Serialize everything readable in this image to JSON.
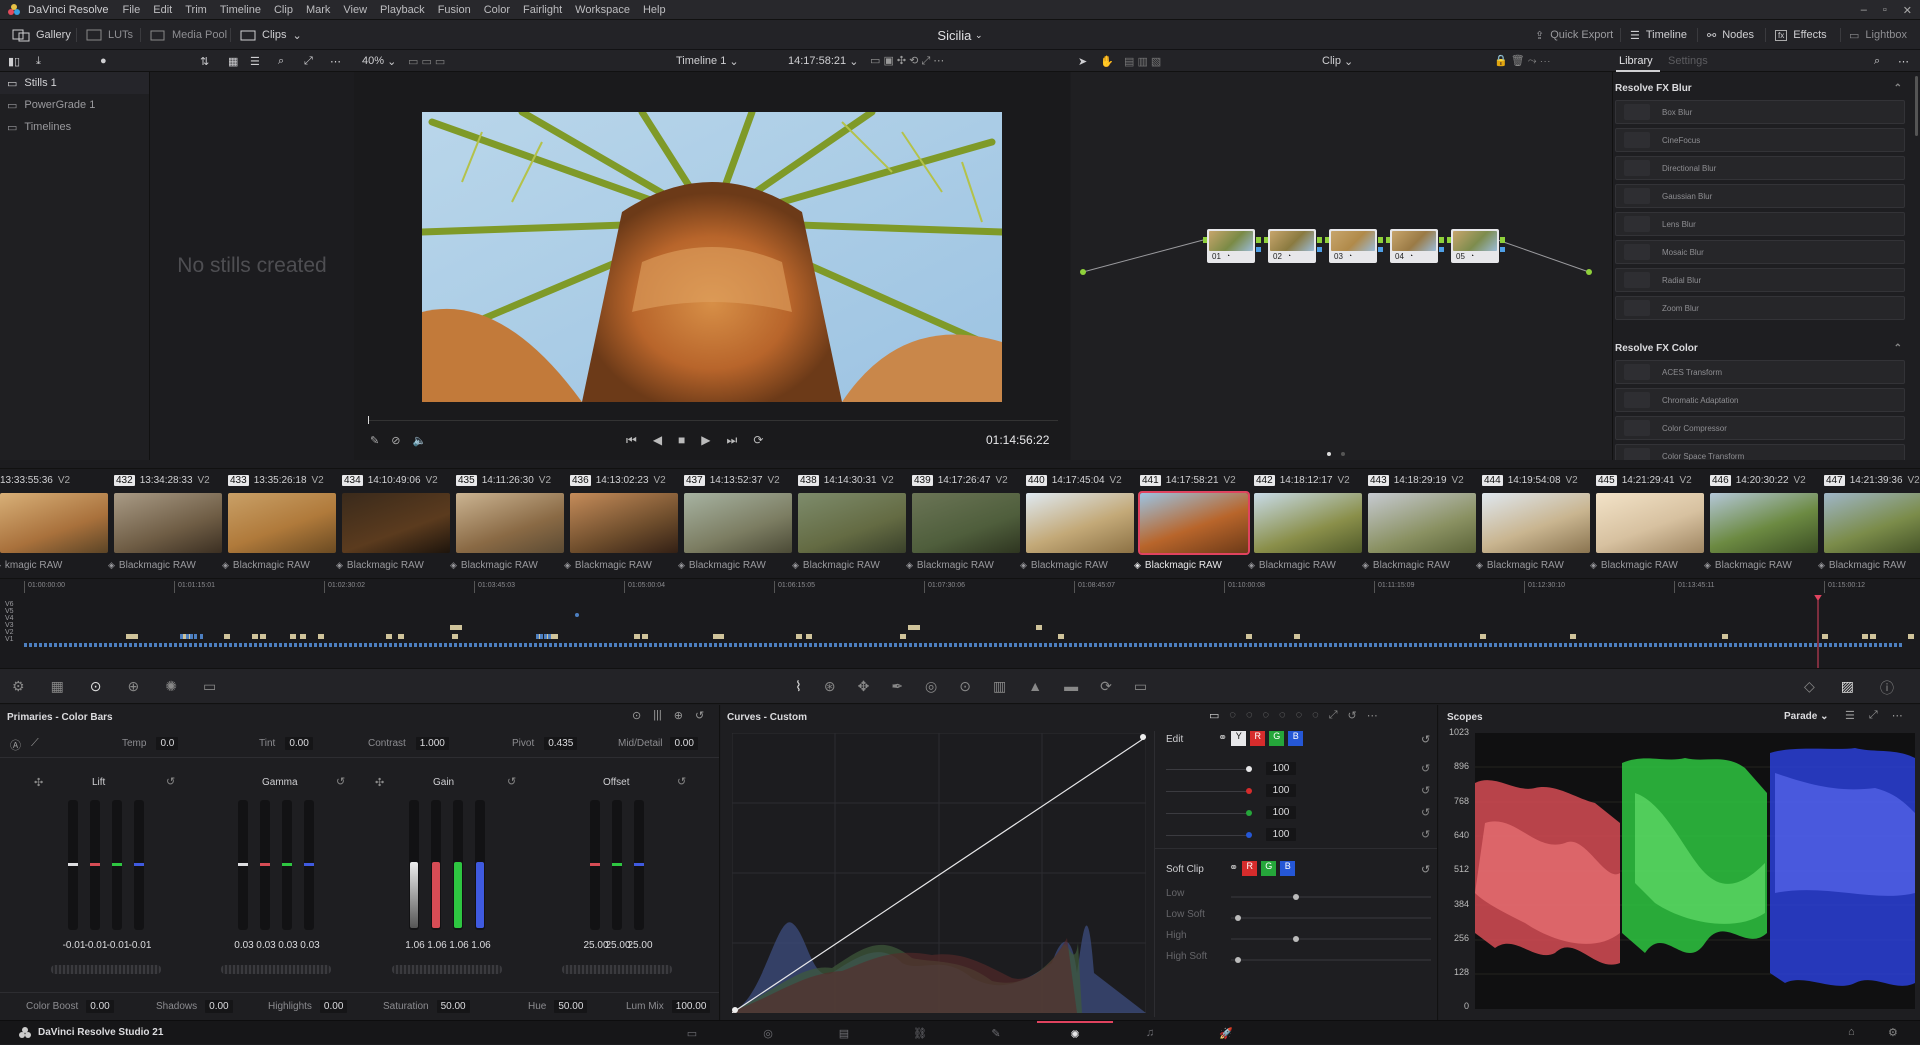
{
  "menubar": {
    "app": "DaVinci Resolve",
    "items": [
      "File",
      "Edit",
      "Trim",
      "Timeline",
      "Clip",
      "Mark",
      "View",
      "Playback",
      "Fusion",
      "Color",
      "Fairlight",
      "Workspace",
      "Help"
    ]
  },
  "header": {
    "gallery": "Gallery",
    "luts": "LUTs",
    "media_pool": "Media Pool",
    "clips": "Clips",
    "project": "Sicilia",
    "quick_export": "Quick Export",
    "timeline": "Timeline",
    "nodes": "Nodes",
    "effects": "Effects",
    "lightbox": "Lightbox"
  },
  "toolbar": {
    "zoom": "40%",
    "timeline_name": "Timeline 1",
    "timecode": "14:17:58:21",
    "clip_mode": "Clip",
    "tab_library": "Library",
    "tab_settings": "Settings"
  },
  "gallery": {
    "items": [
      "Stills 1",
      "PowerGrade 1",
      "Timelines"
    ],
    "empty": "No stills created"
  },
  "viewer": {
    "timecode": "01:14:56:22"
  },
  "nodes": {
    "labels": [
      "01",
      "02",
      "03",
      "04",
      "05"
    ]
  },
  "library": {
    "sections": [
      {
        "title": "Resolve FX Blur",
        "items": [
          "Box Blur",
          "CineFocus",
          "Directional Blur",
          "Gaussian Blur",
          "Lens Blur",
          "Mosaic Blur",
          "Radial Blur",
          "Zoom Blur"
        ]
      },
      {
        "title": "Resolve FX Color",
        "items": [
          "ACES Transform",
          "Chromatic Adaptation",
          "Color Compressor",
          "Color Space Transform"
        ]
      }
    ]
  },
  "clips": [
    {
      "num": "",
      "tc": "13:33:55:36",
      "v": "V2",
      "codec": "kmagic RAW"
    },
    {
      "num": "432",
      "tc": "13:34:28:33",
      "v": "V2",
      "codec": "Blackmagic RAW"
    },
    {
      "num": "433",
      "tc": "13:35:26:18",
      "v": "V2",
      "codec": "Blackmagic RAW"
    },
    {
      "num": "434",
      "tc": "14:10:49:06",
      "v": "V2",
      "codec": "Blackmagic RAW"
    },
    {
      "num": "435",
      "tc": "14:11:26:30",
      "v": "V2",
      "codec": "Blackmagic RAW"
    },
    {
      "num": "436",
      "tc": "14:13:02:23",
      "v": "V2",
      "codec": "Blackmagic RAW"
    },
    {
      "num": "437",
      "tc": "14:13:52:37",
      "v": "V2",
      "codec": "Blackmagic RAW"
    },
    {
      "num": "438",
      "tc": "14:14:30:31",
      "v": "V2",
      "codec": "Blackmagic RAW"
    },
    {
      "num": "439",
      "tc": "14:17:26:47",
      "v": "V2",
      "codec": "Blackmagic RAW"
    },
    {
      "num": "440",
      "tc": "14:17:45:04",
      "v": "V2",
      "codec": "Blackmagic RAW"
    },
    {
      "num": "441",
      "tc": "14:17:58:21",
      "v": "V2",
      "codec": "Blackmagic RAW"
    },
    {
      "num": "442",
      "tc": "14:18:12:17",
      "v": "V2",
      "codec": "Blackmagic RAW"
    },
    {
      "num": "443",
      "tc": "14:18:29:19",
      "v": "V2",
      "codec": "Blackmagic RAW"
    },
    {
      "num": "444",
      "tc": "14:19:54:08",
      "v": "V2",
      "codec": "Blackmagic RAW"
    },
    {
      "num": "445",
      "tc": "14:21:29:41",
      "v": "V2",
      "codec": "Blackmagic RAW"
    },
    {
      "num": "446",
      "tc": "14:20:30:22",
      "v": "V2",
      "codec": "Blackmagic RAW"
    },
    {
      "num": "447",
      "tc": "14:21:39:36",
      "v": "V2",
      "codec": "Blackmagic RAW"
    }
  ],
  "ruler": [
    "01:00:00:00",
    "01:01:15:01",
    "01:02:30:02",
    "01:03:45:03",
    "01:05:00:04",
    "01:06:15:05",
    "01:07:30:06",
    "01:08:45:07",
    "01:10:00:08",
    "01:11:15:09",
    "01:12:30:10",
    "01:13:45:11",
    "01:15:00:12"
  ],
  "tracks": [
    "V6",
    "V5",
    "V4",
    "V3",
    "V2",
    "V1"
  ],
  "primaries": {
    "title": "Primaries - Color Bars",
    "temp_label": "Temp",
    "temp": "0.0",
    "tint_label": "Tint",
    "tint": "0.00",
    "contrast_label": "Contrast",
    "contrast": "1.000",
    "pivot_label": "Pivot",
    "pivot": "0.435",
    "md_label": "Mid/Detail",
    "md": "0.00",
    "wheels": [
      {
        "name": "Lift",
        "vals": [
          "-0.01",
          "-0.01",
          "-0.01",
          "-0.01"
        ]
      },
      {
        "name": "Gamma",
        "vals": [
          "0.03",
          "0.03",
          "0.03",
          "0.03"
        ]
      },
      {
        "name": "Gain",
        "vals": [
          "1.06",
          "1.06",
          "1.06",
          "1.06"
        ]
      },
      {
        "name": "Offset",
        "vals": [
          "25.00",
          "25.00",
          "25.00"
        ]
      }
    ],
    "cb_label": "Color Boost",
    "cb": "0.00",
    "sh_label": "Shadows",
    "sh": "0.00",
    "hl_label": "Highlights",
    "hl": "0.00",
    "sat_label": "Saturation",
    "sat": "50.00",
    "hue_label": "Hue",
    "hue": "50.00",
    "lm_label": "Lum Mix",
    "lm": "100.00"
  },
  "curves": {
    "title": "Curves - Custom",
    "edit": "Edit",
    "y": "Y",
    "r": "R",
    "g": "G",
    "b": "B",
    "vals": [
      "100",
      "100",
      "100",
      "100"
    ],
    "softclip": "Soft Clip",
    "low": "Low",
    "lowsoft": "Low Soft",
    "high": "High",
    "highsoft": "High Soft"
  },
  "scopes": {
    "title": "Scopes",
    "mode": "Parade",
    "scale": [
      "1023",
      "896",
      "768",
      "640",
      "512",
      "384",
      "256",
      "128",
      "0"
    ]
  },
  "footer": {
    "brand": "DaVinci Resolve Studio 21"
  },
  "colors": {
    "accent": "#e0435f",
    "node_green": "#8fd13b",
    "active_clip": "#e0435f"
  }
}
